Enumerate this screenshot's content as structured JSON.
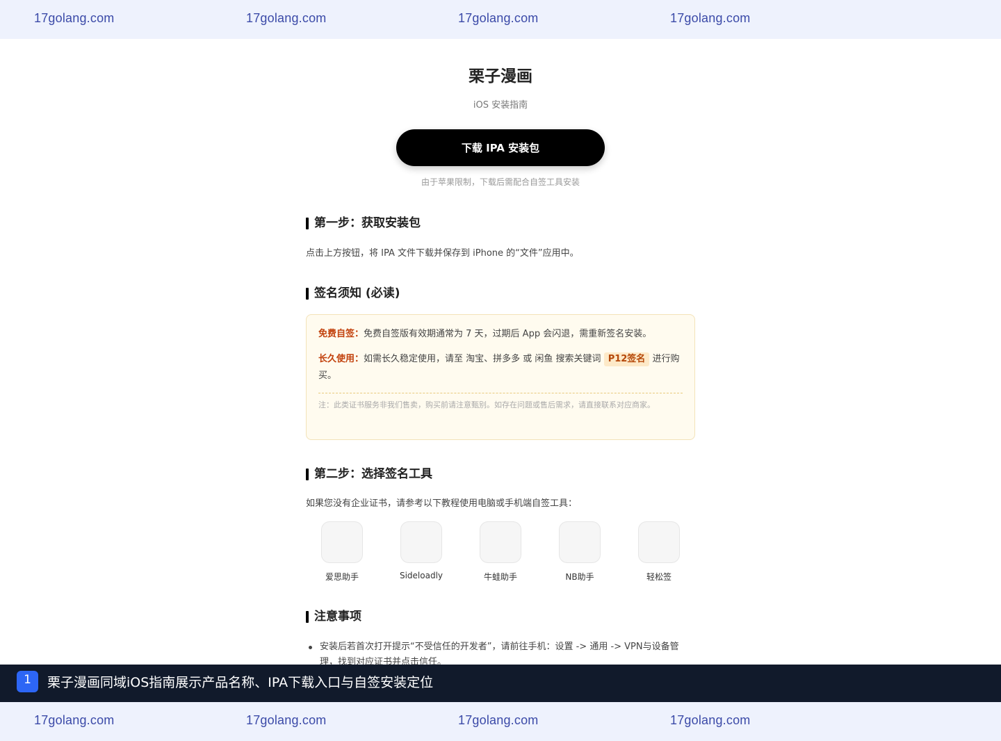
{
  "watermark": {
    "text": "17golang.com"
  },
  "app": {
    "title": "栗子漫画",
    "subtitle": "iOS 安装指南",
    "download_label": "下载 IPA 安装包",
    "download_hint": "由于苹果限制，下载后需配合自签工具安装"
  },
  "step1": {
    "title": "第一步：获取安装包",
    "body": "点击上方按钮，将 IPA 文件下载并保存到 iPhone 的“文件”应用中。"
  },
  "signing": {
    "title": "签名须知 (必读)",
    "free_label": "免费自签：",
    "free_text": "免费自签版有效期通常为 7 天，过期后 App 会闪退，需重新签名安装。",
    "long_label": "长久使用：",
    "long_text_before": "如需长久稳定使用，请至 淘宝、拼多多 或 闲鱼 搜索关键词",
    "long_keyword": "P12签名",
    "long_text_after": "进行购买。",
    "note": "注：此类证书服务非我们售卖，购买前请注意甄别。如存在问题或售后需求，请直接联系对应商家。"
  },
  "step2": {
    "title": "第二步：选择签名工具",
    "body": "如果您没有企业证书，请参考以下教程使用电脑或手机端自签工具：",
    "tools": [
      {
        "label": "爱思助手"
      },
      {
        "label": "Sideloadly"
      },
      {
        "label": "牛蛙助手"
      },
      {
        "label": "NB助手"
      },
      {
        "label": "轻松签"
      }
    ]
  },
  "notes": {
    "title": "注意事项",
    "items": [
      "安装后若首次打开提示“不受信任的开发者”，请前往手机：设置 -> 通用 -> VPN与设备管理，找到对应证书并点击信任。"
    ]
  },
  "caption": {
    "index": "1",
    "text": "栗子漫画同域iOS指南展示产品名称、IPA下载入口与自签安装定位"
  },
  "colors": {
    "accent": "#000000",
    "warning_label": "#c2410c",
    "caption_bg": "#111a2b",
    "badge": "#2d66f5"
  }
}
